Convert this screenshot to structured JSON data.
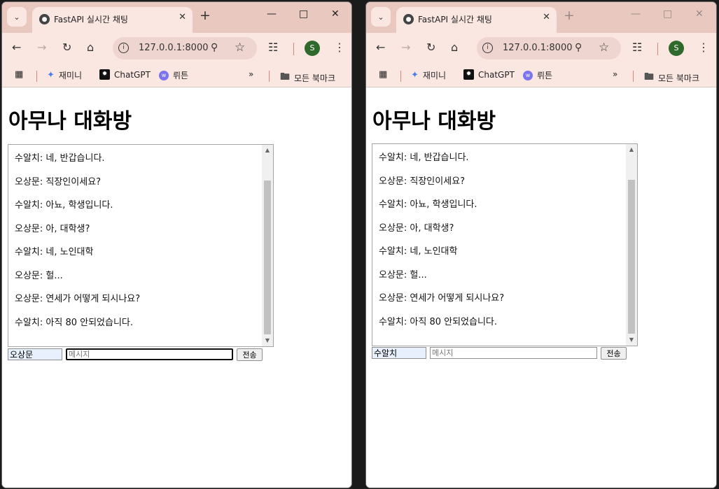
{
  "windows": [
    {
      "tab_title": "FastAPI 실시간 채팅",
      "url": "127.0.0.1:8000",
      "profile_initial": "S",
      "bookmarks": [
        "재미니",
        "ChatGPT",
        "뤼튼"
      ],
      "all_bookmarks_label": "모든 북마크",
      "page": {
        "heading": "아무나 대화방",
        "messages": [
          "수알치: 네, 반갑습니다.",
          "오상문: 직장인이세요?",
          "수알치: 아뇨, 학생입니다.",
          "오상문: 아, 대학생?",
          "수알치: 네, 노인대학",
          "오상문: 헐...",
          "오상문: 연세가 어떻게 되시나요?",
          "수알치: 아직 80 안되었습니다."
        ],
        "name_value": "오상문",
        "message_placeholder": "메시지",
        "send_label": "전송"
      }
    },
    {
      "tab_title": "FastAPI 실시간 채팅",
      "url": "127.0.0.1:8000",
      "profile_initial": "S",
      "bookmarks": [
        "재미니",
        "ChatGPT",
        "뤼튼"
      ],
      "all_bookmarks_label": "모든 북마크",
      "page": {
        "heading": "아무나 대화방",
        "messages": [
          "수알치: 네, 반갑습니다.",
          "오상문: 직장인이세요?",
          "수알치: 아뇨, 학생입니다.",
          "오상문: 아, 대학생?",
          "수알치: 네, 노인대학",
          "오상문: 헐...",
          "오상문: 연세가 어떻게 되시나요?",
          "수알치: 아직 80 안되었습니다."
        ],
        "name_value": "수알치",
        "message_placeholder": "메시지",
        "send_label": "전송"
      }
    }
  ]
}
